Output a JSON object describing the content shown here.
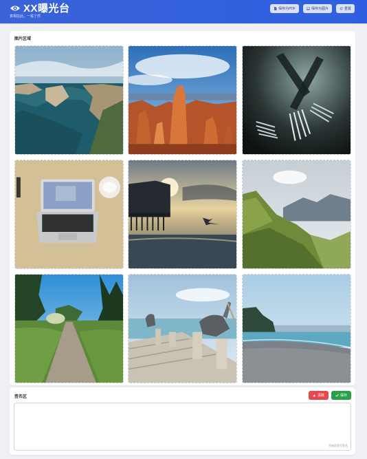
{
  "header": {
    "title": "XX曝光台",
    "subtitle": "真相在此，一看了然",
    "buttons": [
      {
        "label": "保存为PDF",
        "icon": "file-pdf-icon"
      },
      {
        "label": "保存为图片",
        "icon": "image-icon"
      },
      {
        "label": "重置",
        "icon": "refresh-icon"
      }
    ]
  },
  "gallery": {
    "title": "图片区域",
    "photos": [
      {
        "scene": "coastal cliffs"
      },
      {
        "scene": "canyon hoodoos"
      },
      {
        "scene": "forks"
      },
      {
        "scene": "laptop on desk"
      },
      {
        "scene": "pier at sunset with gull"
      },
      {
        "scene": "green mountains"
      },
      {
        "scene": "forest path"
      },
      {
        "scene": "pelicans on pier"
      },
      {
        "scene": "pebble beach"
      }
    ]
  },
  "signature": {
    "title": "签名区",
    "clear_label": "清除",
    "save_label": "保存",
    "hint": "开始您签写签名"
  },
  "colors": {
    "header": "#2f5fe0",
    "clear": "#e5484d",
    "save": "#27a047"
  }
}
